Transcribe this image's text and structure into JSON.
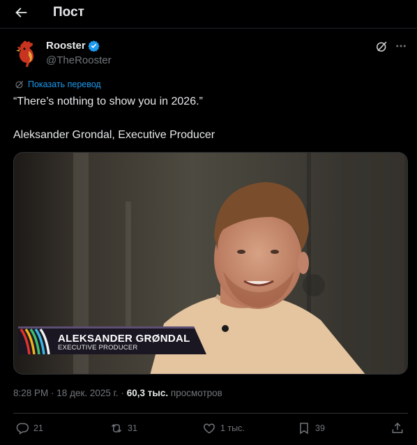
{
  "header": {
    "title": "Пост"
  },
  "post": {
    "author_name": "Rooster",
    "author_handle": "@TheRooster",
    "translate_label": "Показать перевод",
    "text_line1": "“There’s nothing to show you in 2026.”",
    "text_line2": "Aleksander Grondal, Executive Producer",
    "media": {
      "lower_third_name": "ALEKSANDER GRØNDAL",
      "lower_third_role": "EXECUTIVE PRODUCER"
    },
    "time": "8:28 PM",
    "date": "18 дек. 2025 г.",
    "views_count": "60,3 тыс.",
    "views_label": "просмотров"
  },
  "actions": {
    "replies": "21",
    "reposts": "31",
    "likes": "1 тыс.",
    "bookmarks": "39"
  },
  "colors": {
    "accent": "#1d9bf0",
    "muted": "#71767b",
    "text": "#e7e9ea",
    "background": "#000000"
  },
  "icons": [
    "back-arrow-icon",
    "verified-badge-icon",
    "grok-icon",
    "more-icon",
    "translate-icon",
    "reply-icon",
    "repost-icon",
    "like-icon",
    "bookmark-icon",
    "share-icon"
  ]
}
